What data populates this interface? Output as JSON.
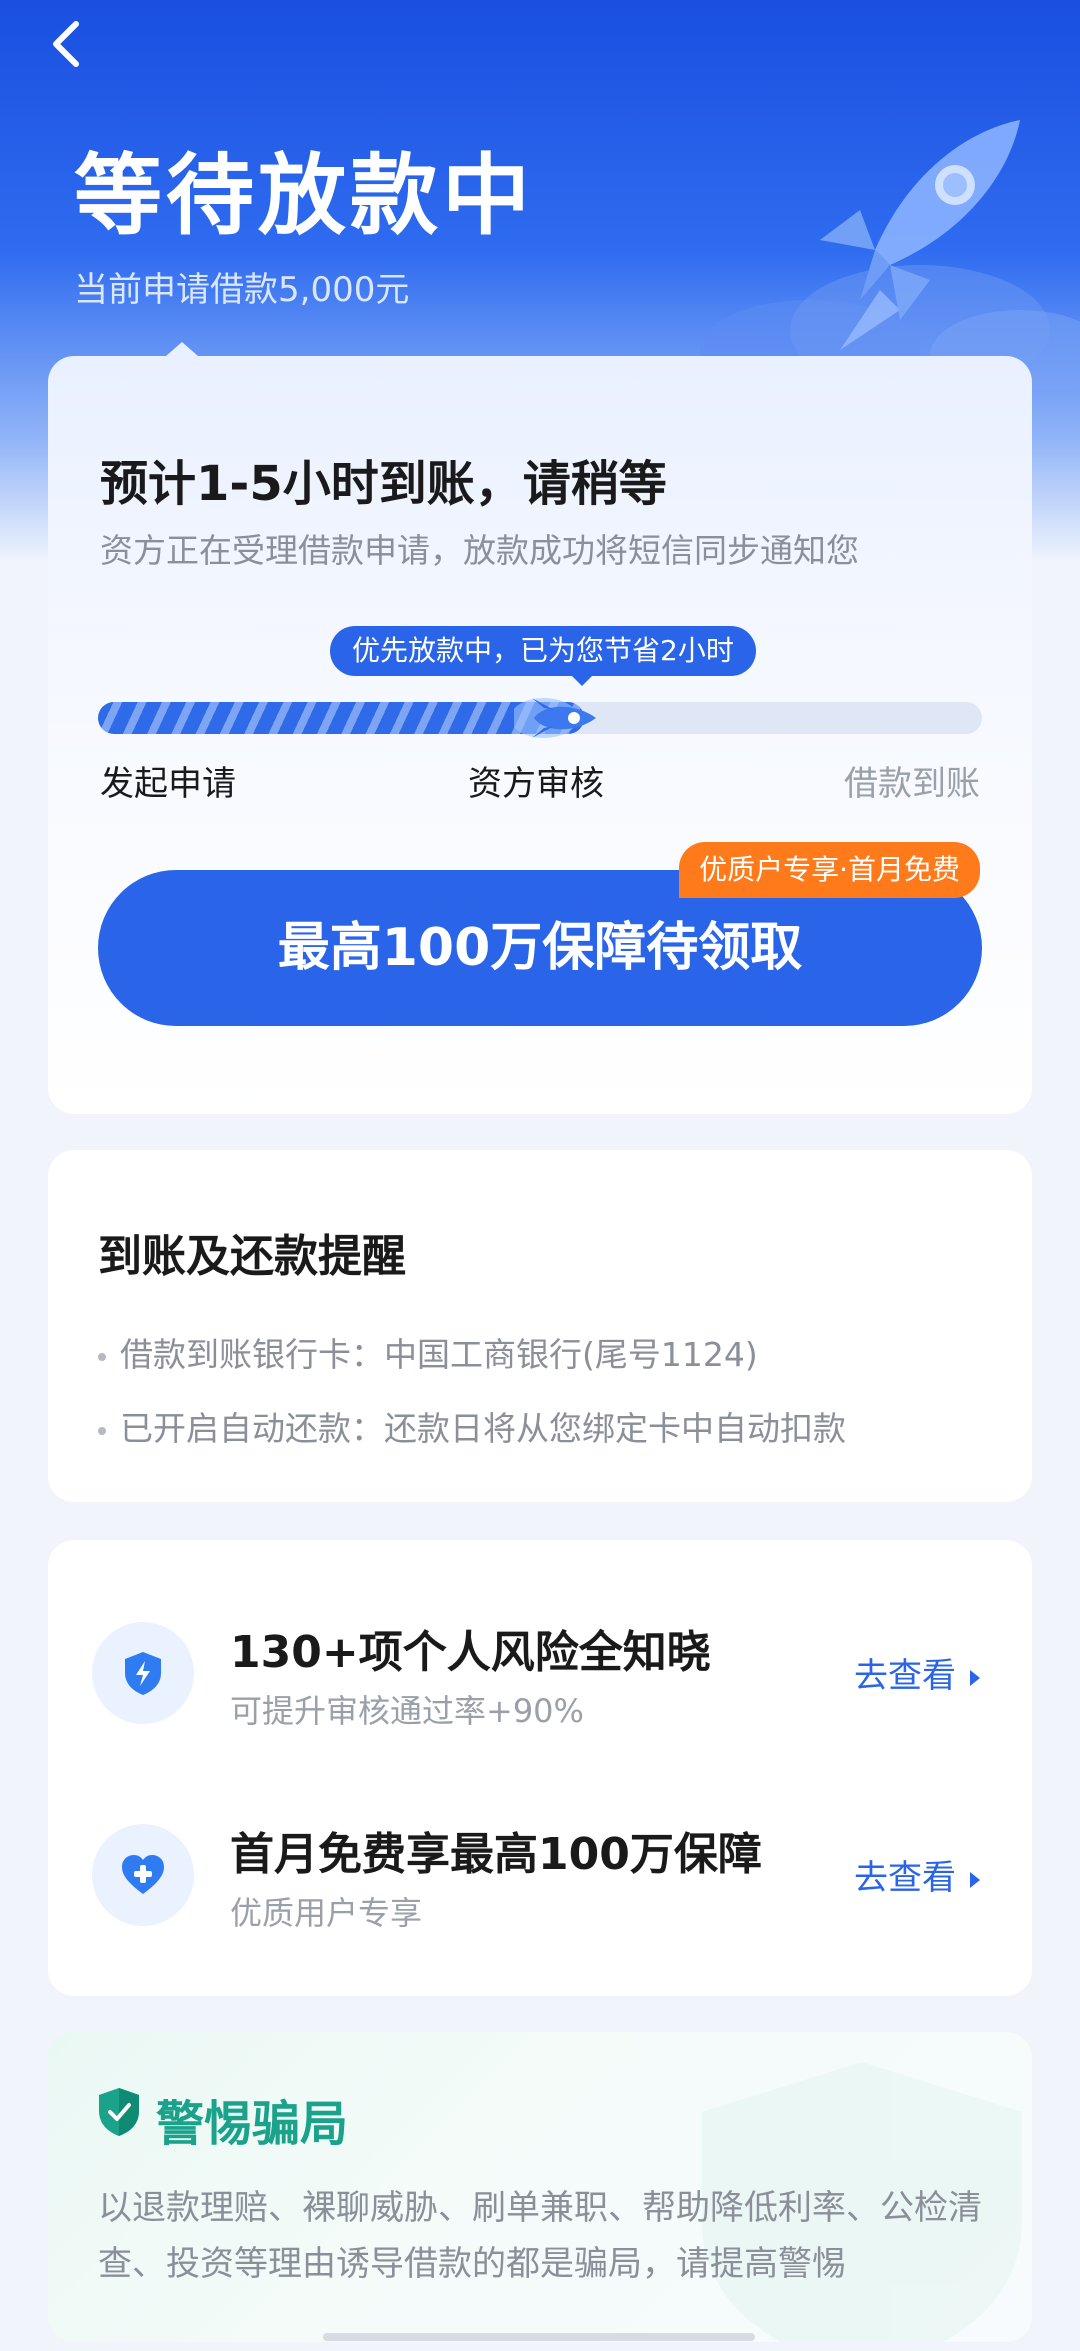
{
  "header": {
    "title": "等待放款中",
    "subtitle": "当前申请借款5,000元"
  },
  "status_card": {
    "title": "预计1-5小时到账，请稍等",
    "description": "资方正在受理借款申请，放款成功将短信同步通知您",
    "tooltip": "优先放款中，已为您节省2小时",
    "progress": 0.55,
    "steps": [
      "发起申请",
      "资方审核",
      "借款到账"
    ],
    "cta_label": "最高100万保障待领取",
    "cta_badge": "优质户专享·首月免费"
  },
  "reminder_card": {
    "title": "到账及还款提醒",
    "items": [
      "借款到账银行卡：中国工商银行(尾号1124)",
      "已开启自动还款：还款日将从您绑定卡中自动扣款"
    ]
  },
  "services": [
    {
      "icon": "shield-lightning-icon",
      "title": "130+项个人风险全知晓",
      "subtitle": "可提升审核通过率+90%",
      "link": "去查看"
    },
    {
      "icon": "heart-plus-icon",
      "title": "首月免费享最高100万保障",
      "subtitle": "优质用户专享",
      "link": "去查看"
    }
  ],
  "fraud_warning": {
    "title": "警惕骗局",
    "body": "以退款理赔、裸聊威胁、刷单兼职、帮助降低利率、公检清查、投资等理由诱导借款的都是骗局，请提高警惕"
  },
  "colors": {
    "primary": "#2a64e8",
    "badge": "#ff7a1a",
    "warning_green": "#1aa38a"
  }
}
